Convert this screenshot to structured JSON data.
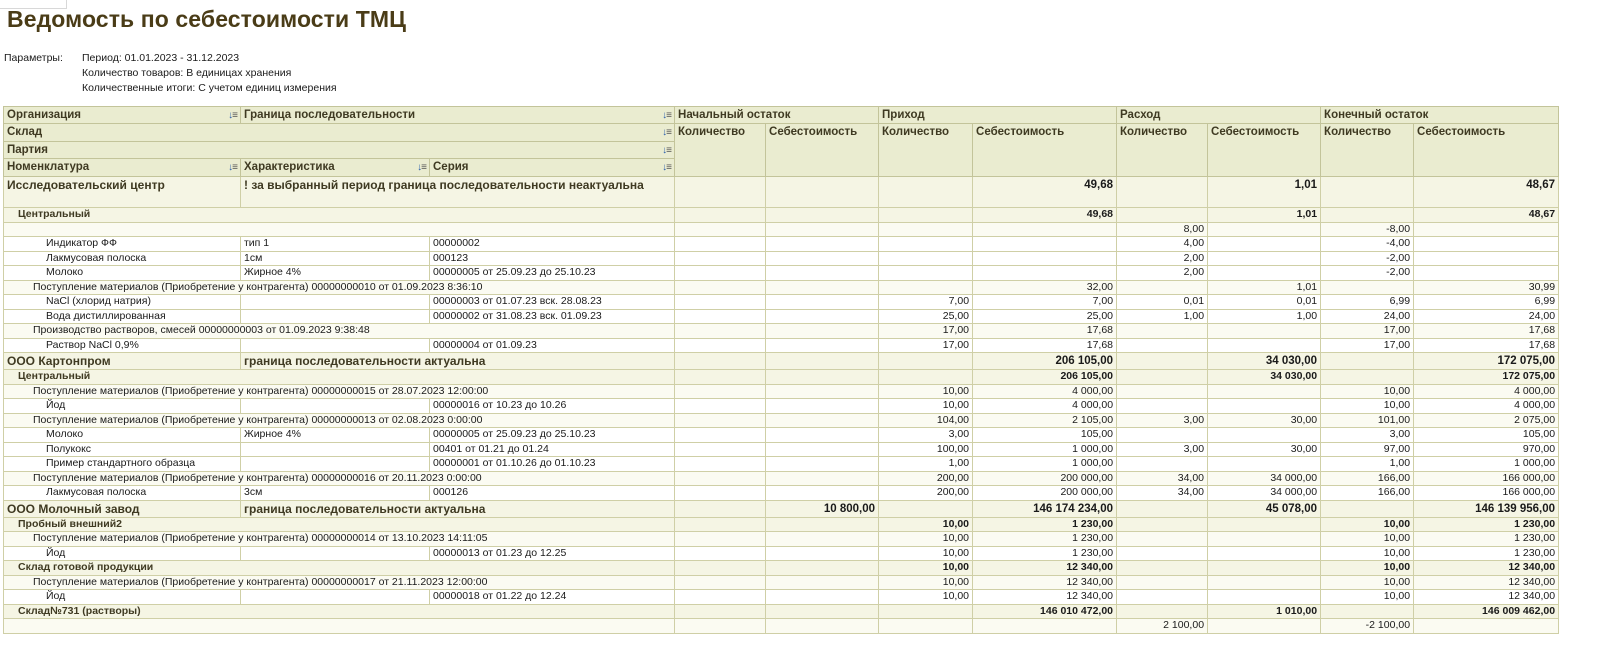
{
  "title": "Ведомость по себестоимости ТМЦ",
  "params": {
    "label": "Параметры:",
    "period": "Период: 01.01.2023 - 31.12.2023",
    "qty": "Количество товаров: В единицах хранения",
    "totals": "Количественные итоги: С учетом единиц измерения"
  },
  "header": {
    "org": "Организация",
    "boundary": "Граница последовательности",
    "sklad": "Склад",
    "party": "Партия",
    "nomen": "Номенклатура",
    "char": "Характеристика",
    "series": "Серия",
    "start": "Начальный остаток",
    "income": "Приход",
    "expense": "Расход",
    "end": "Конечный остаток",
    "qty": "Количество",
    "cost": "Себестоимость"
  },
  "orgs": [
    {
      "name": "Исследовательский центр",
      "status": "! за выбранный период граница последовательности неактуальна",
      "inc_cost": "49,68",
      "exp_cost": "1,01",
      "end_cost": "48,67",
      "sklad": {
        "name": "Центральный",
        "inc_cost": "49,68",
        "exp_cost": "1,01",
        "end_cost": "48,67"
      },
      "blank": {
        "exp_qty": "8,00",
        "end_qty": "-8,00"
      },
      "items1": [
        {
          "nom": "Индикатор ФФ",
          "char": "тип 1",
          "series": "00000002",
          "exp_qty": "4,00",
          "end_qty": "-4,00"
        },
        {
          "nom": "Лакмусовая полоска",
          "char": "1см",
          "series": "000123",
          "exp_qty": "2,00",
          "end_qty": "-2,00"
        },
        {
          "nom": "Молоко",
          "char": "Жирное 4%",
          "series": "00000005 от 25.09.23 до 25.10.23",
          "exp_qty": "2,00",
          "end_qty": "-2,00"
        }
      ],
      "doc1": {
        "name": "Поступление материалов (Приобретение у контрагента) 00000000010 от 01.09.2023 8:36:10",
        "inc_cost": "32,00",
        "exp_cost": "1,01",
        "end_cost": "30,99"
      },
      "items2": [
        {
          "nom": "NaCl (хлорид натрия)",
          "series": "00000003 от 01.07.23 вск. 28.08.23",
          "inc_qty": "7,00",
          "inc_cost": "7,00",
          "exp_qty": "0,01",
          "exp_cost": "0,01",
          "end_qty": "6,99",
          "end_cost": "6,99"
        },
        {
          "nom": "Вода  дистиллированная",
          "series": "00000002 от 31.08.23 вск. 01.09.23",
          "inc_qty": "25,00",
          "inc_cost": "25,00",
          "exp_qty": "1,00",
          "exp_cost": "1,00",
          "end_qty": "24,00",
          "end_cost": "24,00"
        }
      ],
      "doc2": {
        "name": "Производство растворов, смесей 00000000003 от 01.09.2023 9:38:48",
        "inc_qty": "17,00",
        "inc_cost": "17,68",
        "end_qty": "17,00",
        "end_cost": "17,68"
      },
      "item3": {
        "nom": "Раствор NaCl 0,9%",
        "series": "00000004 от 01.09.23",
        "inc_qty": "17,00",
        "inc_cost": "17,68",
        "end_qty": "17,00",
        "end_cost": "17,68"
      }
    },
    {
      "name": "ООО Картонпром",
      "status": "граница последовательности актуальна",
      "inc_cost": "206 105,00",
      "exp_cost": "34 030,00",
      "end_cost": "172 075,00",
      "sklad": {
        "name": "Центральный",
        "inc_cost": "206 105,00",
        "exp_cost": "34 030,00",
        "end_cost": "172 075,00"
      },
      "doc1": {
        "name": "Поступление материалов (Приобретение у контрагента) 00000000015 от 28.07.2023 12:00:00",
        "inc_qty": "10,00",
        "inc_cost": "4 000,00",
        "end_qty": "10,00",
        "end_cost": "4 000,00"
      },
      "i1": {
        "nom": "Йод",
        "series": "00000016 от 10.23 до 10.26",
        "inc_qty": "10,00",
        "inc_cost": "4 000,00",
        "end_qty": "10,00",
        "end_cost": "4 000,00"
      },
      "doc2": {
        "name": "Поступление материалов (Приобретение у контрагента) 00000000013 от 02.08.2023 0:00:00",
        "inc_qty": "104,00",
        "inc_cost": "2 105,00",
        "exp_qty": "3,00",
        "exp_cost": "30,00",
        "end_qty": "101,00",
        "end_cost": "2 075,00"
      },
      "i2": {
        "nom": "Молоко",
        "char": "Жирное 4%",
        "series": "00000005 от 25.09.23 до 25.10.23",
        "inc_qty": "3,00",
        "inc_cost": "105,00",
        "end_qty": "3,00",
        "end_cost": "105,00"
      },
      "i3": {
        "nom": "Полукокс",
        "series": "00401 от 01.21 до 01.24",
        "inc_qty": "100,00",
        "inc_cost": "1 000,00",
        "exp_qty": "3,00",
        "exp_cost": "30,00",
        "end_qty": "97,00",
        "end_cost": "970,00"
      },
      "i4": {
        "nom": "Пример стандартного образца",
        "series": "00000001 от 01.10.26 до 01.10.23",
        "inc_qty": "1,00",
        "inc_cost": "1 000,00",
        "end_qty": "1,00",
        "end_cost": "1 000,00"
      },
      "doc3": {
        "name": "Поступление материалов (Приобретение у контрагента) 00000000016 от 20.11.2023 0:00:00",
        "inc_qty": "200,00",
        "inc_cost": "200 000,00",
        "exp_qty": "34,00",
        "exp_cost": "34 000,00",
        "end_qty": "166,00",
        "end_cost": "166 000,00"
      },
      "i5": {
        "nom": "Лакмусовая полоска",
        "char": "3см",
        "series": "000126",
        "inc_qty": "200,00",
        "inc_cost": "200 000,00",
        "exp_qty": "34,00",
        "exp_cost": "34 000,00",
        "end_qty": "166,00",
        "end_cost": "166 000,00"
      }
    },
    {
      "name": "ООО Молочный завод",
      "status": "граница последовательности актуальна",
      "start_cost": "10 800,00",
      "inc_cost": "146 174 234,00",
      "exp_cost": "45 078,00",
      "end_cost": "146 139 956,00",
      "sk1": {
        "name": "Пробный внешний2",
        "inc_qty": "10,00",
        "inc_cost": "1 230,00",
        "end_qty": "10,00",
        "end_cost": "1 230,00"
      },
      "doc1": {
        "name": "Поступление материалов (Приобретение у контрагента) 00000000014 от 13.10.2023 14:11:05",
        "inc_qty": "10,00",
        "inc_cost": "1 230,00",
        "end_qty": "10,00",
        "end_cost": "1 230,00"
      },
      "i1": {
        "nom": "Йод",
        "series": "00000013 от 01.23 до 12.25",
        "inc_qty": "10,00",
        "inc_cost": "1 230,00",
        "end_qty": "10,00",
        "end_cost": "1 230,00"
      },
      "sk2": {
        "name": "Склад готовой продукции",
        "inc_qty": "10,00",
        "inc_cost": "12 340,00",
        "end_qty": "10,00",
        "end_cost": "12 340,00"
      },
      "doc2": {
        "name": "Поступление материалов (Приобретение у контрагента) 00000000017 от 21.11.2023 12:00:00",
        "inc_qty": "10,00",
        "inc_cost": "12 340,00",
        "end_qty": "10,00",
        "end_cost": "12 340,00"
      },
      "i2": {
        "nom": "Йод",
        "series": "00000018 от 01.22 до 12.24",
        "inc_qty": "10,00",
        "inc_cost": "12 340,00",
        "end_qty": "10,00",
        "end_cost": "12 340,00"
      },
      "sk3": {
        "name": "Склад№731 (растворы)",
        "inc_cost": "146 010 472,00",
        "exp_cost": "1 010,00",
        "end_cost": "146 009 462,00"
      },
      "last": {
        "exp_qty": "2 100,00",
        "end_qty": "-2 100,00"
      }
    }
  ]
}
